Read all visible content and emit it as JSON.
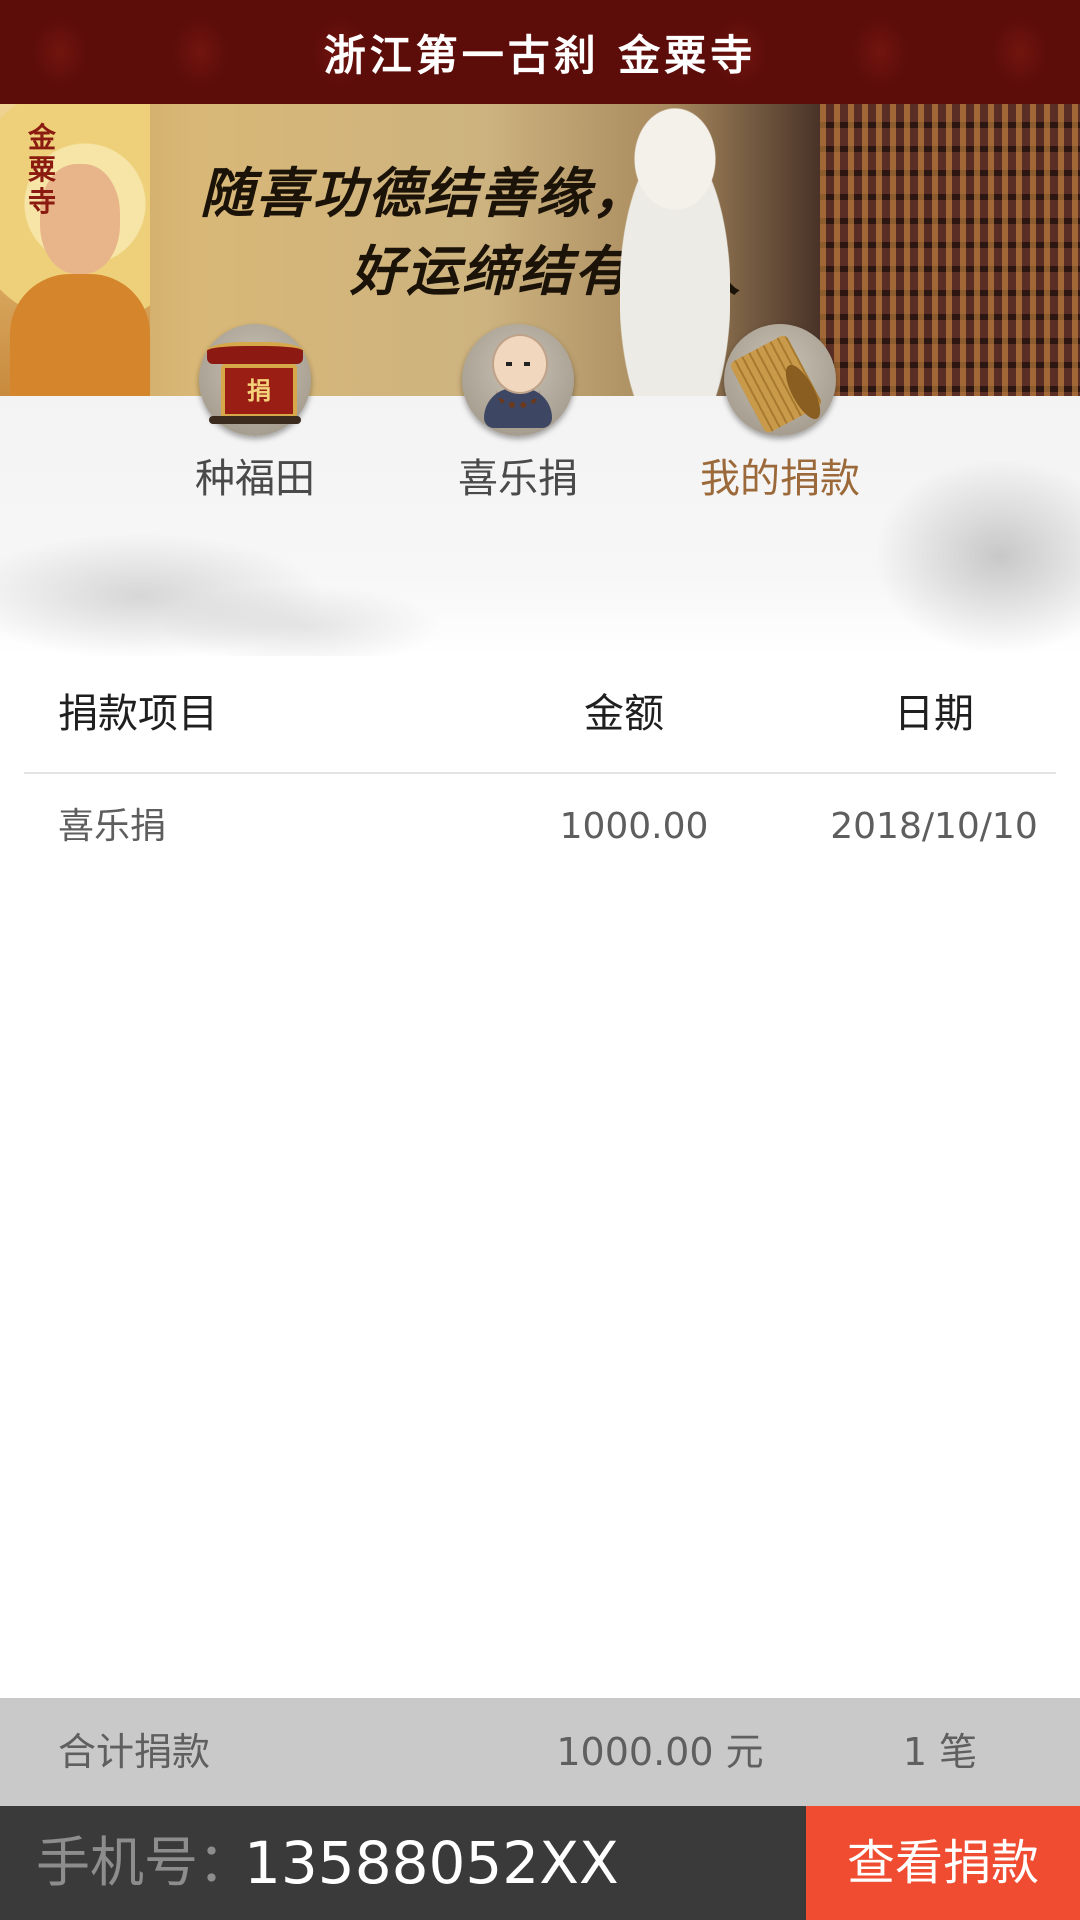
{
  "header": {
    "title": "浙江第一古刹 金粟寺"
  },
  "banner": {
    "logo": "金粟寺",
    "motto_line1": "随喜功德结善缘，",
    "motto_line2": "好运缔结有缘人"
  },
  "tabs": [
    {
      "label": "种福田",
      "icon": "shrine-donation-icon",
      "active": false
    },
    {
      "label": "喜乐捐",
      "icon": "monk-icon",
      "active": false
    },
    {
      "label": "我的捐款",
      "icon": "scroll-icon",
      "active": true
    }
  ],
  "table": {
    "headers": [
      "捐款项目",
      "金额",
      "日期"
    ],
    "rows": [
      {
        "item": "喜乐捐",
        "amount": "1000.00",
        "date": "2018/10/10"
      }
    ]
  },
  "summary": {
    "label": "合计捐款",
    "amount": "1000.00 元",
    "count": "1 笔"
  },
  "footer": {
    "phone_label": "手机号：",
    "phone_value": "13588052XX",
    "button_label": "查看捐款"
  },
  "colors": {
    "header_bg": "#5c0d0a",
    "active_tab": "#9c6a3a",
    "button_bg": "#f04c31",
    "summary_bg": "#c9c9c9",
    "footer_bg": "#3a3a3a"
  }
}
